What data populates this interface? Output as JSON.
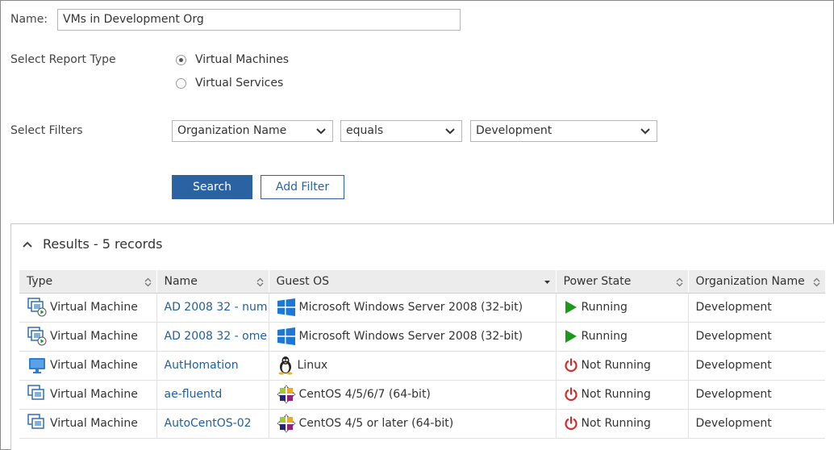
{
  "form": {
    "name_label": "Name:",
    "name_value": "VMs in Development Org",
    "report_type_label": "Select Report Type",
    "report_types": [
      {
        "label": "Virtual Machines",
        "selected": true
      },
      {
        "label": "Virtual Services",
        "selected": false
      }
    ],
    "filters_label": "Select Filters",
    "filter_field": "Organization Name",
    "filter_operator": "equals",
    "filter_value": "Development",
    "search_label": "Search",
    "add_filter_label": "Add Filter"
  },
  "results": {
    "title": "Results - 5 records",
    "columns": [
      "Type",
      "Name",
      "Guest OS",
      "Power State",
      "Organization Name"
    ],
    "rows": [
      {
        "type": "Virtual Machine",
        "type_icon": "vm-running-icon",
        "name": "AD 2008 32 - num",
        "os": "Microsoft Windows Server 2008 (32-bit)",
        "os_icon": "windows-icon",
        "power": "Running",
        "power_icon": "play-icon",
        "org": "Development"
      },
      {
        "type": "Virtual Machine",
        "type_icon": "vm-running-icon",
        "name": "AD 2008 32 - ome",
        "os": "Microsoft Windows Server 2008 (32-bit)",
        "os_icon": "windows-icon",
        "power": "Running",
        "power_icon": "play-icon",
        "org": "Development"
      },
      {
        "type": "Virtual Machine",
        "type_icon": "vm-monitor-icon",
        "name": "AutHomation",
        "os": "Linux",
        "os_icon": "linux-tux-icon",
        "power": "Not Running",
        "power_icon": "power-off-icon",
        "org": "Development"
      },
      {
        "type": "Virtual Machine",
        "type_icon": "vm-stopped-icon",
        "name": "ae-fluentd",
        "os": "CentOS 4/5/6/7 (64-bit)",
        "os_icon": "centos-icon",
        "power": "Not Running",
        "power_icon": "power-off-icon",
        "org": "Development"
      },
      {
        "type": "Virtual Machine",
        "type_icon": "vm-stopped-icon",
        "name": "AutoCentOS-02",
        "os": "CentOS 4/5 or later (64-bit)",
        "os_icon": "centos-icon",
        "power": "Not Running",
        "power_icon": "power-off-icon",
        "org": "Development"
      }
    ]
  },
  "colors": {
    "primary": "#2a62a3",
    "link": "#1f5fa3",
    "running": "#1a9a1a",
    "stopped": "#d32a2a"
  }
}
